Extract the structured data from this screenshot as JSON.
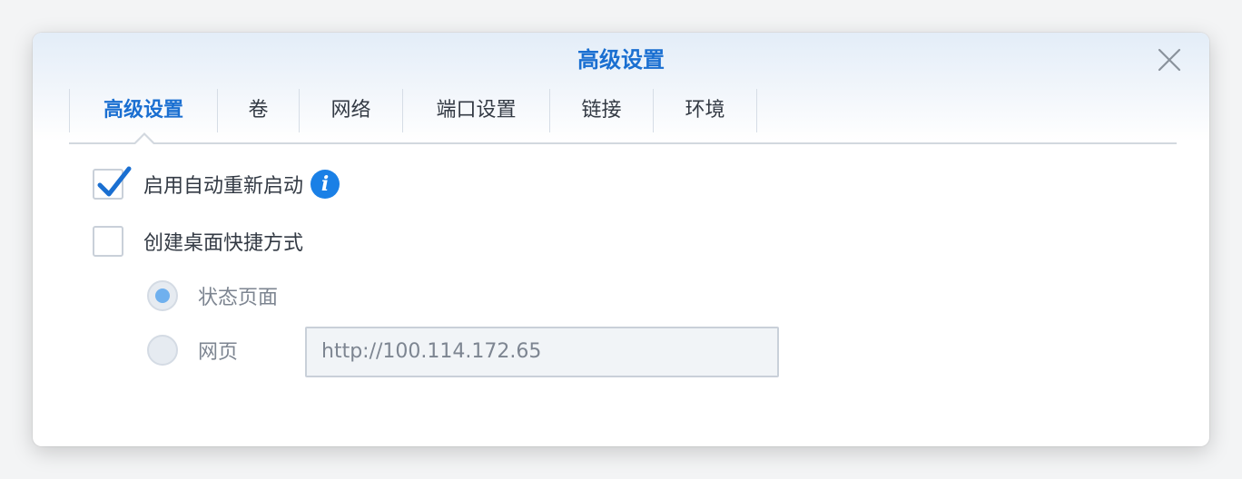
{
  "dialog": {
    "title": "高级设置",
    "close_icon": "close-icon"
  },
  "tabs": [
    {
      "label": "高级设置",
      "active": true
    },
    {
      "label": "卷",
      "active": false
    },
    {
      "label": "网络",
      "active": false
    },
    {
      "label": "端口设置",
      "active": false
    },
    {
      "label": "链接",
      "active": false
    },
    {
      "label": "环境",
      "active": false
    }
  ],
  "options": {
    "auto_restart": {
      "label": "启用自动重新启动",
      "checked": true,
      "info_icon": "info-icon"
    },
    "desktop_shortcut": {
      "label": "创建桌面快捷方式",
      "checked": false
    },
    "shortcut_type": {
      "status_page": {
        "label": "状态页面",
        "selected": true
      },
      "web_page": {
        "label": "网页",
        "selected": false
      },
      "url_value": "http://100.114.172.65"
    }
  },
  "colors": {
    "accent": "#1a6fd1",
    "info": "#1a80e6",
    "radio_dot": "#6fb0ee"
  }
}
